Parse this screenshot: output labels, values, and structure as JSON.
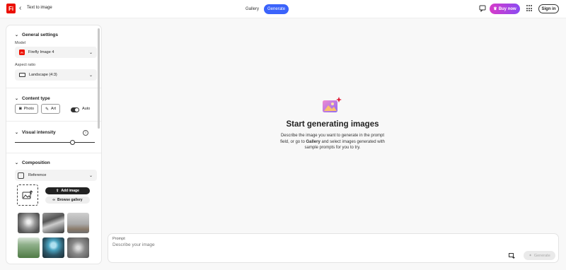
{
  "header": {
    "logo_text": "Fi",
    "back_label": "Text to image",
    "tabs": [
      {
        "label": "Gallery"
      },
      {
        "label": "Generate"
      }
    ],
    "buy_now": "Buy now",
    "sign_in": "Sign in"
  },
  "panel": {
    "general": {
      "title": "General settings",
      "model_label": "Model",
      "model_value": "Firefly Image 4",
      "model_icon_text": "Fi",
      "aspect_label": "Aspect ratio",
      "aspect_value": "Landscape (4:3)"
    },
    "content_type": {
      "title": "Content type",
      "photo": "Photo",
      "art": "Art",
      "auto": "Auto"
    },
    "visual_intensity": {
      "title": "Visual intensity",
      "value": 0.72
    },
    "composition": {
      "title": "Composition",
      "reference": "Reference",
      "add_image": "Add image",
      "browse_gallery": "Browse gallery"
    }
  },
  "main": {
    "title": "Start generating images",
    "desc_before": "Describe the image you want to generate in the prompt field, or go to ",
    "desc_bold": "Gallery",
    "desc_after": " and select images generated with sample prompts for you to try."
  },
  "prompt": {
    "label": "Prompt",
    "placeholder": "Describe your image",
    "generate": "Generate"
  },
  "colors": {
    "accent": "#3b63fb",
    "brand": "#eb1000"
  }
}
